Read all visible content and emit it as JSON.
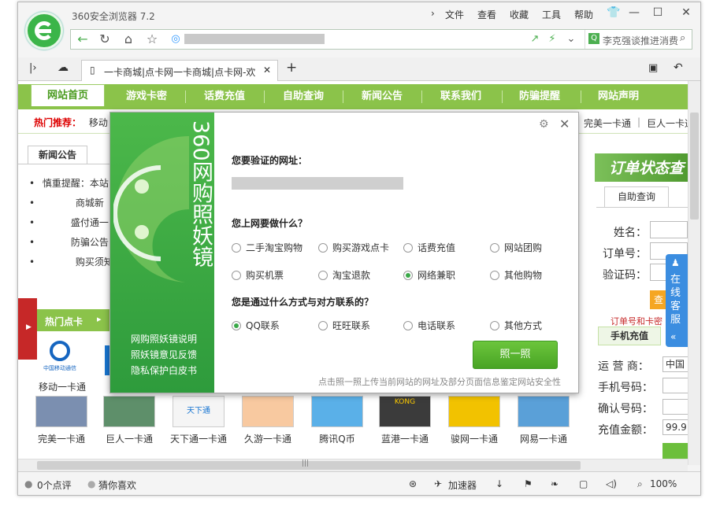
{
  "app": {
    "title": "360安全浏览器 7.2"
  },
  "menu": [
    "文件",
    "查看",
    "收藏",
    "工具",
    "帮助"
  ],
  "search": {
    "text": "李克强谈推进消费"
  },
  "tab": {
    "title": "一卡商城|点卡网一卡商城|点卡网-欢"
  },
  "site": {
    "nav": [
      "网站首页",
      "游戏卡密",
      "话费充值",
      "自助查询",
      "新闻公告",
      "联系我们",
      "防骗提醒",
      "网站声明"
    ],
    "hot_label": "热门推荐：",
    "hot_items": [
      "移动",
      "完美一卡通",
      "巨人一卡通"
    ],
    "news_tab": "新闻公告",
    "news": [
      "慎重提醒：本站",
      "商城新",
      "盛付通一",
      "防骗公告",
      "购买须知"
    ],
    "hot_cards_tab": "热门点卡",
    "cards_row1": [
      "移动一卡通"
    ],
    "cards_row2": [
      "完美一卡通",
      "巨人一卡通",
      "天下通一卡通",
      "久游一卡通",
      "腾讯Q币",
      "蓝港一卡通",
      "骏网一卡通",
      "网易一卡通"
    ],
    "order_title": "订单状态查",
    "order_tab": "自助查询",
    "order_fields": [
      "姓名：",
      "订单号：",
      "验证码："
    ],
    "order_hint": "订单号和卡密",
    "phone_tab": "手机充值",
    "phone_fields": [
      "运 营 商：",
      "手机号码：",
      "确认号码：",
      "充值金额："
    ],
    "phone_values": [
      "中国",
      "",
      "",
      "99.9"
    ],
    "service": "在线客服"
  },
  "dialog": {
    "title_vertical": "360网购照妖镜",
    "links": [
      "网购照妖镜说明",
      "照妖镜意见反馈",
      "隐私保护白皮书"
    ],
    "q1": "您要验证的网址：",
    "q2": "您上网要做什么？",
    "options1": [
      "二手淘宝购物",
      "购买游戏点卡",
      "话费充值",
      "网站团购",
      "购买机票",
      "淘宝退款",
      "网络兼职",
      "其他购物"
    ],
    "q3": "您是通过什么方式与对方联系的？",
    "options2": [
      "QQ联系",
      "旺旺联系",
      "电话联系",
      "其他方式"
    ],
    "button": "照一照",
    "note": "点击照一照上传当前网站的网址及部分页面信息鉴定网站安全性",
    "selected1": "网络兼职",
    "selected2": "QQ联系"
  },
  "status": {
    "comments": "0个点评",
    "guess": "猜你喜欢",
    "accel": "加速器",
    "zoom": "100%"
  }
}
